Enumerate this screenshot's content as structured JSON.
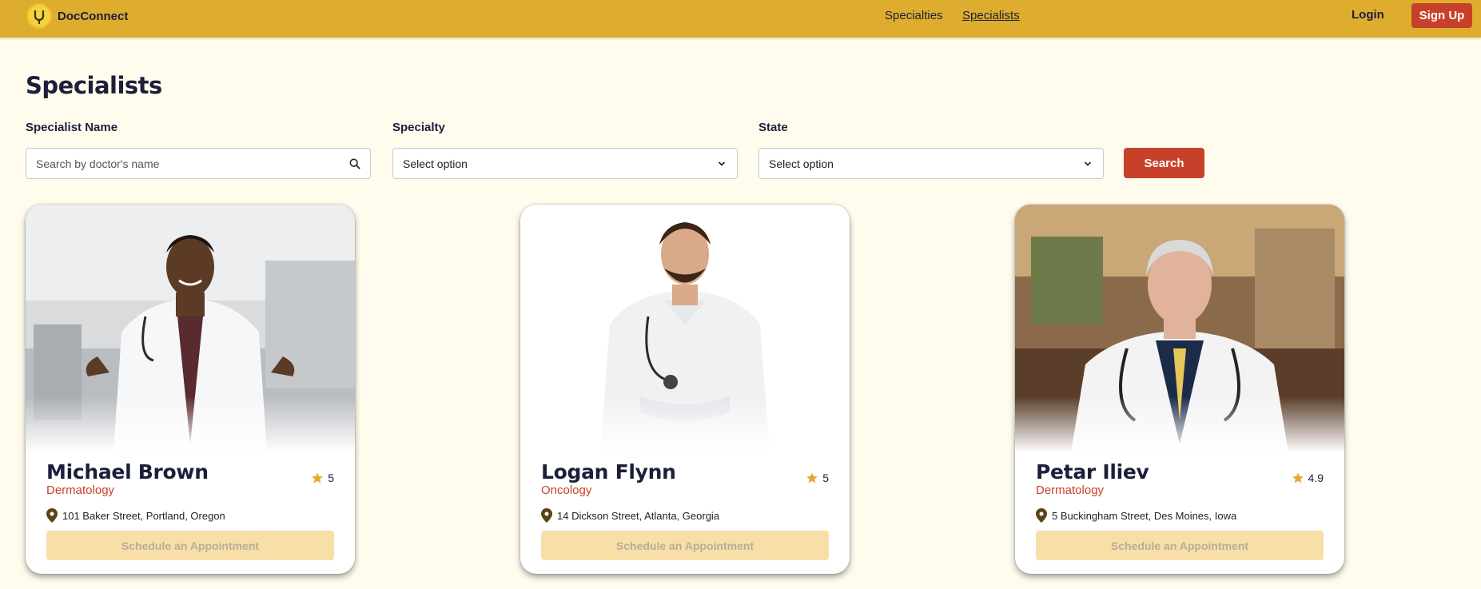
{
  "header": {
    "brand": "DocConnect",
    "nav": [
      "Specialties",
      "Specialists"
    ],
    "active_nav": "Specialists",
    "login_label": "Login",
    "signup_label": "Sign Up"
  },
  "page": {
    "title": "Specialists"
  },
  "filters": {
    "name_label": "Specialist Name",
    "name_placeholder": "Search by doctor's name",
    "specialty_label": "Specialty",
    "specialty_value": "Select option",
    "state_label": "State",
    "state_value": "Select option",
    "search_label": "Search"
  },
  "colors": {
    "header_bg": "#dfad2d",
    "accent_red": "#c7412a",
    "page_bg": "#fffcee",
    "star": "#dfad2d",
    "pin": "#5a4512"
  },
  "specialists": [
    {
      "name": "Michael Brown",
      "specialty": "Dermatology",
      "rating": "5",
      "address": "101 Baker Street, Portland, Oregon",
      "button": "Schedule an Appointment"
    },
    {
      "name": "Logan Flynn",
      "specialty": "Oncology",
      "rating": "5",
      "address": "14 Dickson Street, Atlanta, Georgia",
      "button": "Schedule an Appointment"
    },
    {
      "name": "Petar Iliev",
      "specialty": "Dermatology",
      "rating": "4.9",
      "address": "5 Buckingham Street, Des Moines, Iowa",
      "button": "Schedule an Appointment"
    }
  ]
}
